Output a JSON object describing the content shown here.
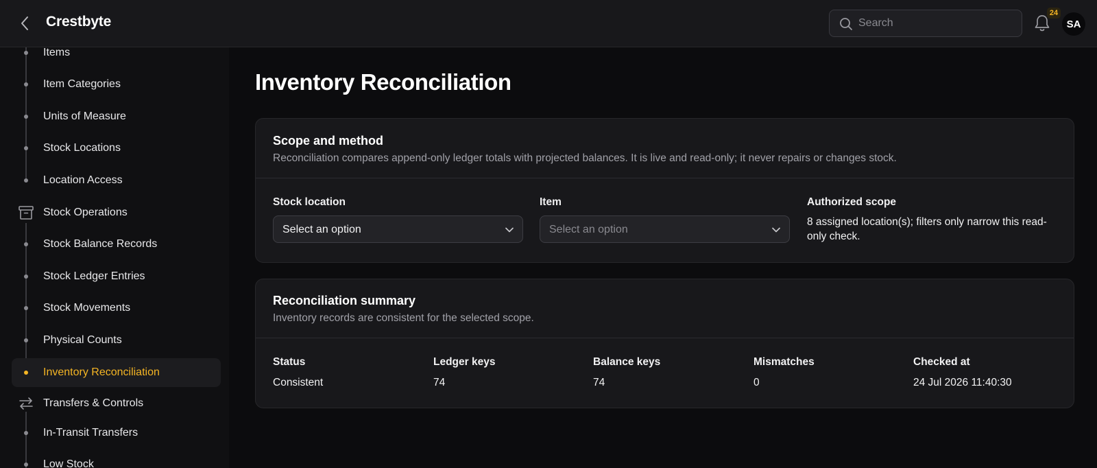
{
  "header": {
    "brand": "Crestbyte",
    "search_placeholder": "Search",
    "notifications_count": "24",
    "avatar_initials": "SA"
  },
  "sidebar": {
    "items": [
      {
        "label": "Items",
        "type": "child"
      },
      {
        "label": "Item Categories",
        "type": "child"
      },
      {
        "label": "Units of Measure",
        "type": "child"
      },
      {
        "label": "Stock Locations",
        "type": "child"
      },
      {
        "label": "Location Access",
        "type": "child"
      },
      {
        "label": "Stock Operations",
        "type": "group",
        "icon": "archive-icon"
      },
      {
        "label": "Stock Balance Records",
        "type": "child"
      },
      {
        "label": "Stock Ledger Entries",
        "type": "child"
      },
      {
        "label": "Stock Movements",
        "type": "child"
      },
      {
        "label": "Physical Counts",
        "type": "child"
      },
      {
        "label": "Inventory Reconciliation",
        "type": "child",
        "active": true
      },
      {
        "label": "Transfers & Controls",
        "type": "group",
        "icon": "transfer-arrows-icon"
      },
      {
        "label": "In-Transit Transfers",
        "type": "child"
      },
      {
        "label": "Low Stock",
        "type": "child"
      }
    ]
  },
  "page": {
    "title": "Inventory Reconciliation"
  },
  "scope_card": {
    "title": "Scope and method",
    "description": "Reconciliation compares append-only ledger totals with projected balances. It is live and read-only; it never repairs or changes stock.",
    "stock_location_label": "Stock location",
    "stock_location_value": "Select an option",
    "item_label": "Item",
    "item_placeholder": "Select an option",
    "authorized_scope_label": "Authorized scope",
    "authorized_scope_text": "8 assigned location(s); filters only narrow this read-only check."
  },
  "summary_card": {
    "title": "Reconciliation summary",
    "description": "Inventory records are consistent for the selected scope.",
    "columns": [
      {
        "label": "Status",
        "value": "Consistent"
      },
      {
        "label": "Ledger keys",
        "value": "74"
      },
      {
        "label": "Balance keys",
        "value": "74"
      },
      {
        "label": "Mismatches",
        "value": "0"
      },
      {
        "label": "Checked at",
        "value": "24 Jul 2026 11:40:30"
      }
    ]
  },
  "colors": {
    "accent": "#f5b524",
    "background": "#0c0c0e",
    "surface": "#18181b"
  }
}
